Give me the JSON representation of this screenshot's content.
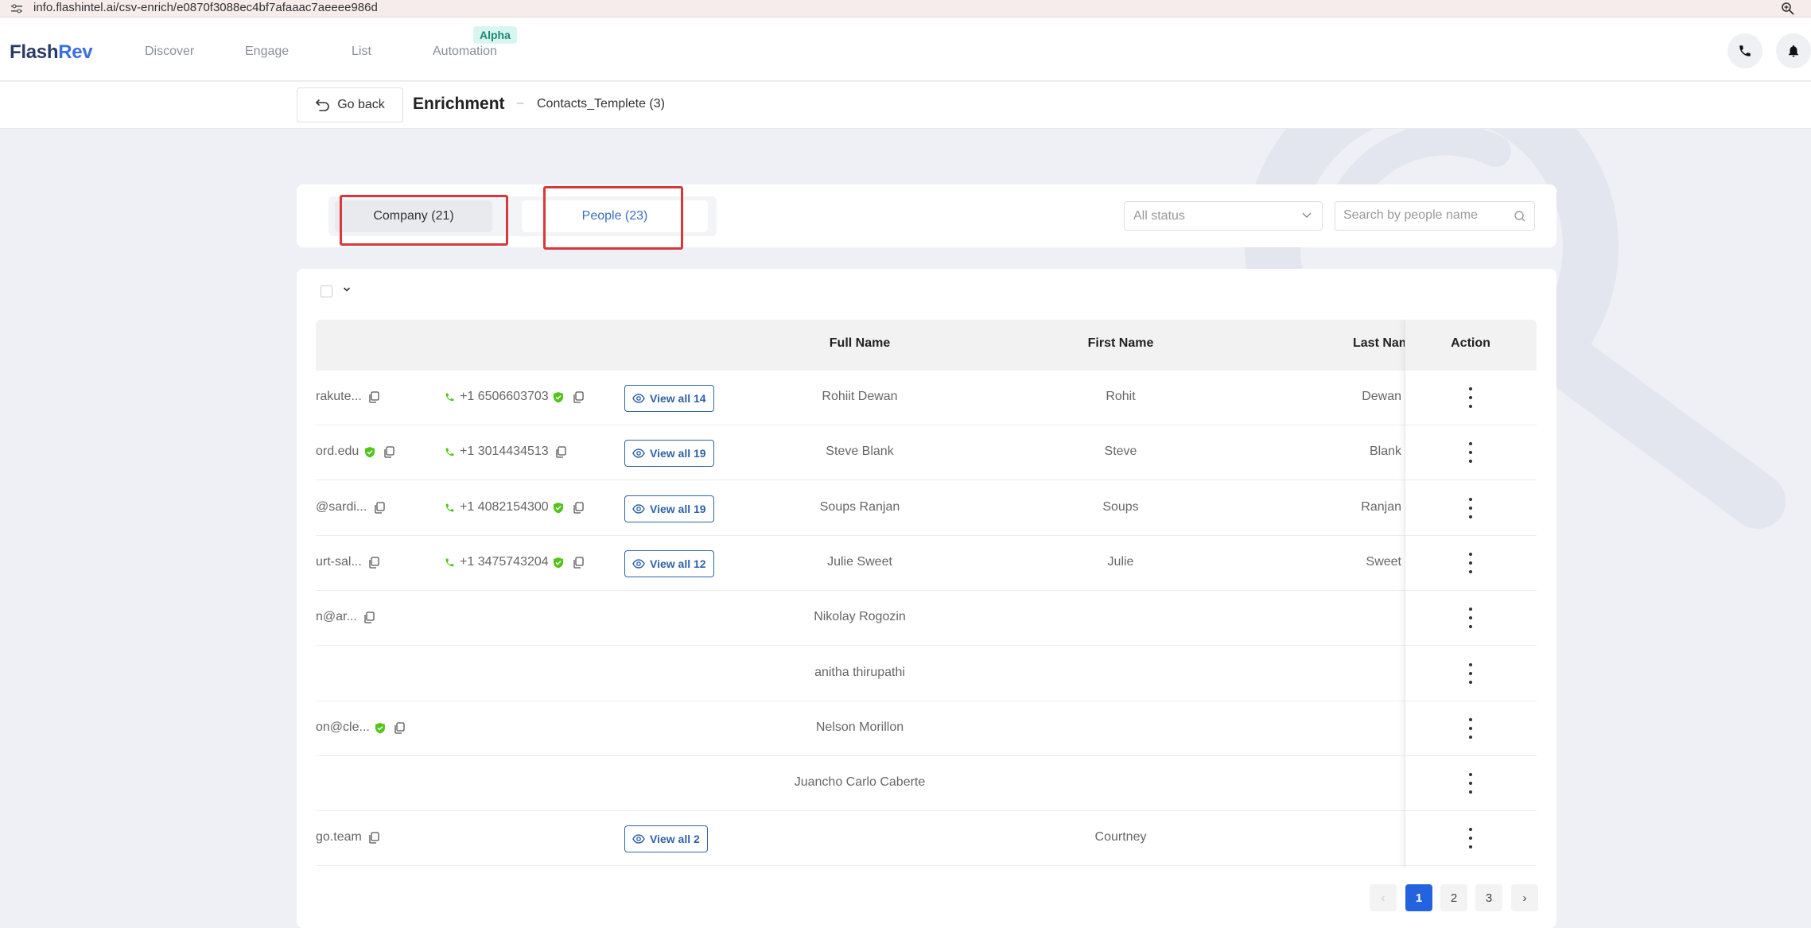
{
  "browser": {
    "url": "info.flashintel.ai/csv-enrich/e0870f3088ec4bf7afaaac7aeeee986d"
  },
  "brand": {
    "part1": "Flash",
    "part2": "Rev",
    "dark": "#2b3a67",
    "accent": "#3a6fe0"
  },
  "nav": {
    "items": [
      "Discover",
      "Engage",
      "List",
      "Automation"
    ],
    "badge": "Alpha",
    "icons": [
      "phone-icon",
      "bell-icon"
    ]
  },
  "header": {
    "back_label": "Go back",
    "title": "Enrichment",
    "separator": "–",
    "file": "Contacts_Templete (3)"
  },
  "tabs": {
    "company": "Company (21)",
    "people": "People (23)",
    "active": "people"
  },
  "filters": {
    "status_value": "All status",
    "search_placeholder": "Search by people name"
  },
  "table": {
    "columns": {
      "full_name": "Full Name",
      "first_name": "First Name",
      "last_name": "Last Nam",
      "action": "Action"
    },
    "rows": [
      {
        "email": "rakute...",
        "email_verified": false,
        "phone": "+1 6506603703",
        "phone_verified": true,
        "view_all": "View all 14",
        "full_name": "Rohiit Dewan",
        "first_name": "Rohit",
        "last_name": "Dewan"
      },
      {
        "email": "ord.edu",
        "email_verified": true,
        "phone": "+1 3014434513",
        "phone_verified": false,
        "view_all": "View all 19",
        "full_name": "Steve Blank",
        "first_name": "Steve",
        "last_name": "Blank"
      },
      {
        "email": "@sardi...",
        "email_verified": false,
        "phone": "+1 4082154300",
        "phone_verified": true,
        "view_all": "View all 19",
        "full_name": "Soups Ranjan",
        "first_name": "Soups",
        "last_name": "Ranjan"
      },
      {
        "email": "urt-sal...",
        "email_verified": false,
        "phone": "+1 3475743204",
        "phone_verified": true,
        "view_all": "View all 12",
        "full_name": "Julie Sweet",
        "first_name": "Julie",
        "last_name": "Sweet"
      },
      {
        "email": "n@ar...",
        "email_verified": false,
        "phone": "",
        "phone_verified": false,
        "view_all": "",
        "full_name": "Nikolay Rogozin",
        "first_name": "",
        "last_name": ""
      },
      {
        "email": "",
        "email_verified": false,
        "phone": "",
        "phone_verified": false,
        "view_all": "",
        "full_name": "anitha thirupathi",
        "first_name": "",
        "last_name": ""
      },
      {
        "email": "on@cle...",
        "email_verified": true,
        "phone": "",
        "phone_verified": false,
        "view_all": "",
        "full_name": "Nelson Morillon",
        "first_name": "",
        "last_name": ""
      },
      {
        "email": "",
        "email_verified": false,
        "phone": "",
        "phone_verified": false,
        "view_all": "",
        "full_name": "Juancho Carlo Caberte",
        "first_name": "",
        "last_name": ""
      },
      {
        "email": "go.team",
        "email_verified": false,
        "phone": "",
        "phone_verified": false,
        "view_all": "View all 2",
        "full_name": "",
        "first_name": "Courtney",
        "last_name": ""
      }
    ]
  },
  "pagination": {
    "prev": "‹",
    "pages": [
      "1",
      "2",
      "3"
    ],
    "current": "1",
    "next": "›"
  },
  "colors": {
    "verified": "#52c41a",
    "phone": "#52c41a",
    "link": "#2e62a8",
    "highlight": "#d9383a",
    "page_active": "#2463e0"
  }
}
